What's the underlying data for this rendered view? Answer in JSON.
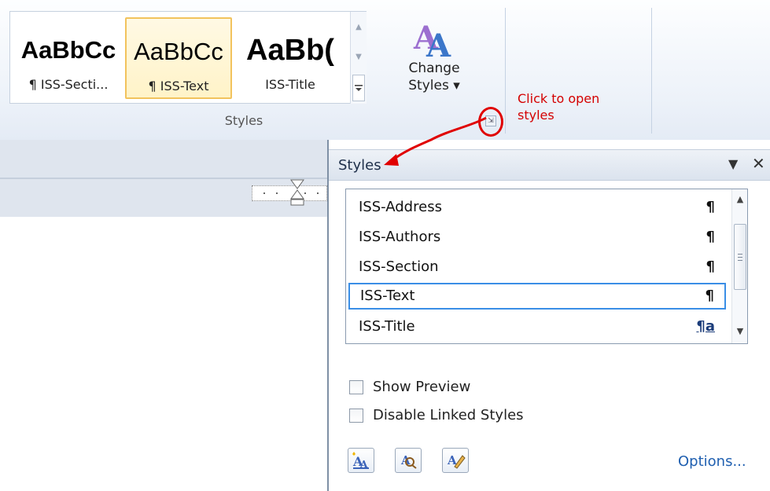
{
  "ribbon": {
    "gallery": [
      {
        "preview": "AaBbCc",
        "name": "¶ ISS-Secti...",
        "selected": false
      },
      {
        "preview": "AaBbCc",
        "name": "¶ ISS-Text",
        "selected": true
      },
      {
        "preview": "AaBb(",
        "name": "ISS-Title",
        "selected": false
      }
    ],
    "change_styles_line1": "Change",
    "change_styles_line2": "Styles ▾",
    "group_label": "Styles"
  },
  "annotation": {
    "line1": "Click to open",
    "line2": "styles"
  },
  "styles_pane": {
    "title": "Styles",
    "menu_icon": "dropdown-arrow-icon",
    "items": [
      {
        "name": "ISS-Address",
        "mark": "¶",
        "linked": false
      },
      {
        "name": "ISS-Authors",
        "mark": "¶",
        "linked": false
      },
      {
        "name": "ISS-Section",
        "mark": "¶",
        "linked": false
      },
      {
        "name": "ISS-Text",
        "mark": "¶",
        "linked": false,
        "selected": true
      },
      {
        "name": "ISS-Title",
        "mark": "¶a",
        "linked": true
      }
    ],
    "show_preview": "Show Preview",
    "disable_linked": "Disable Linked Styles",
    "options_link": "Options...",
    "colors": {
      "selection": "#3a8ee6",
      "annotation": "#d40000",
      "link": "#1f5fb0"
    }
  }
}
